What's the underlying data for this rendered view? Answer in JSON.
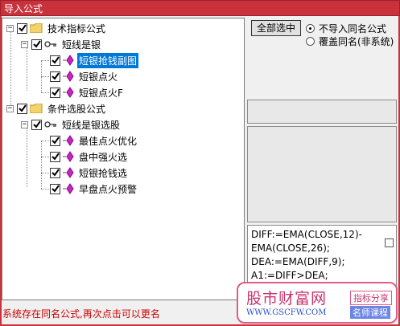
{
  "window": {
    "title": "导入公式"
  },
  "tree": {
    "groups": [
      {
        "label": "技术指标公式",
        "expanded": true,
        "formula": {
          "label": "短线是银",
          "items": [
            "短银抢钱副图",
            "短银点火",
            "短银点火F"
          ]
        }
      },
      {
        "label": "条件选股公式",
        "expanded": true,
        "formula": {
          "label": "短线是银选股",
          "items": [
            "最佳点火优化",
            "盘中强火选",
            "短银抢钱选",
            "早盘点火预警"
          ]
        }
      }
    ],
    "selected": "短银抢钱副图"
  },
  "buttons": {
    "select_all": "全部选中"
  },
  "options": {
    "no_import_same": "不导入同名公式",
    "overwrite_same": "覆盖同名(非系统)",
    "selected": "no_import_same"
  },
  "code": {
    "lines": [
      "DIFF:=EMA(CLOSE,12)-",
      "EMA(CLOSE,26);",
      "DEA:=EMA(DIFF,9);",
      "A1:=DIFF>DEA;"
    ]
  },
  "status": "系统存在同名公式,再次点击可以更名",
  "watermark": {
    "title": "股市财富网",
    "url": "WWW.GSCFW.COM",
    "tag1": "指标分享",
    "tag2": "名师课程"
  },
  "colors": {
    "accent": "#c8323c",
    "selection": "#0078d7",
    "status": "#cc0000"
  }
}
